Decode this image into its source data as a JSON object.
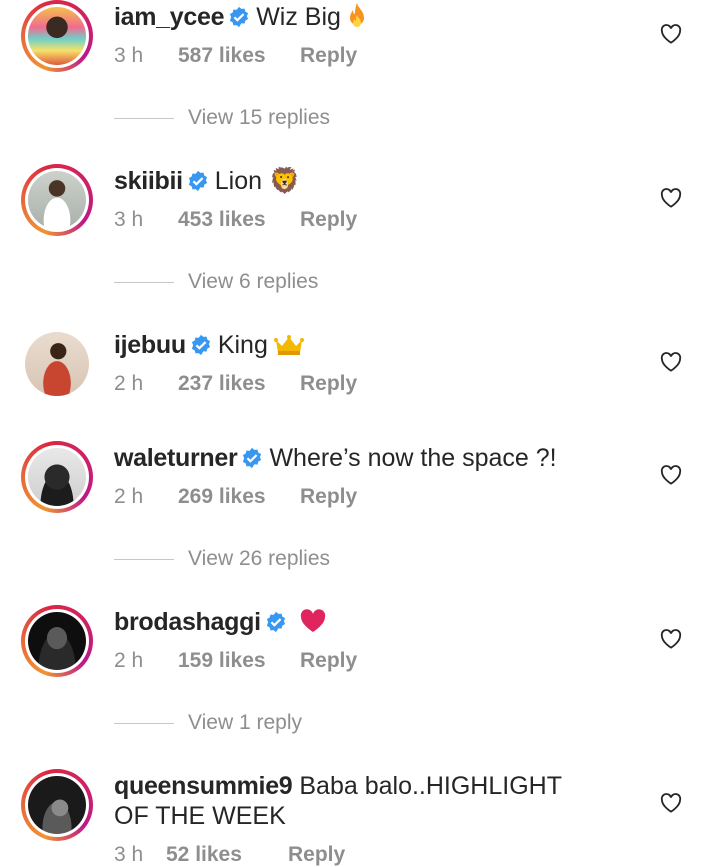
{
  "comments": [
    {
      "username": "iam_ycee",
      "text": "Wiz Big",
      "emoji": "fire",
      "time": "3 h",
      "likes": "587 likes",
      "reply": "Reply",
      "view_replies": "View 15 replies"
    },
    {
      "username": "skiibii",
      "text": "Lion 🦁",
      "emoji": "",
      "time": "3 h",
      "likes": "453 likes",
      "reply": "Reply",
      "view_replies": "View 6 replies"
    },
    {
      "username": "ijebuu",
      "text": "King",
      "emoji": "crown",
      "time": "2 h",
      "likes": "237 likes",
      "reply": "Reply",
      "view_replies": ""
    },
    {
      "username": "waleturner",
      "text": "Where’s now the space ?!",
      "emoji": "",
      "time": "2 h",
      "likes": "269 likes",
      "reply": "Reply",
      "view_replies": "View 26 replies"
    },
    {
      "username": "brodashaggi",
      "text": "",
      "emoji": "red-heart",
      "time": "2 h",
      "likes": "159 likes",
      "reply": "Reply",
      "view_replies": "View 1 reply"
    },
    {
      "username": "queensummie9",
      "text": "Baba balo..HIGHLIGHT OF THE WEEK",
      "emoji": "",
      "time": "3 h",
      "likes": "52 likes",
      "reply": "Reply",
      "view_replies": ""
    }
  ],
  "icons": {
    "verified": "verified-badge-icon",
    "like": "heart-outline-icon"
  },
  "colors": {
    "verified": "#3897f0",
    "meta": "#8e8e8e",
    "text": "#262626",
    "heart": "#e0245e"
  }
}
